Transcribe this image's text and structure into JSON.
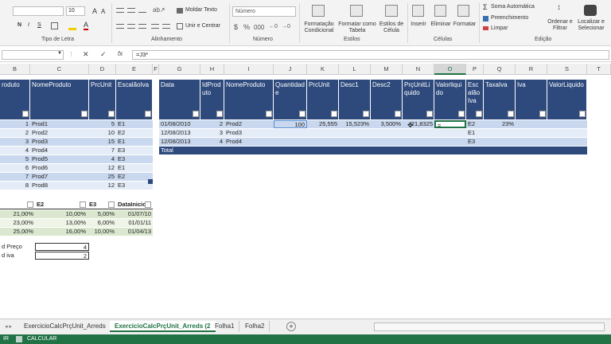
{
  "ribbon": {
    "font_size": "10",
    "groups": {
      "font": "Tipo de Letra",
      "alignment": "Alinhamento",
      "number": "Número",
      "styles": "Estilos",
      "cells": "Células",
      "editing": "Edição"
    },
    "font_style_buttons": {
      "bold": "N",
      "italic": "I",
      "underline": "S"
    },
    "wrap_text": "Moldar Texto",
    "merge_center": "Unir e Centrar",
    "number_format": "Número",
    "cond_format": [
      "Formatação",
      "Condicional"
    ],
    "format_table": [
      "Formatar como",
      "Tabela"
    ],
    "cell_styles": [
      "Estilos de",
      "Célula"
    ],
    "insert": "Inserir",
    "delete": "Eliminar",
    "format": "Formatar",
    "autosum": "Soma Automática",
    "fill": "Preenchimento",
    "clear": "Limpar",
    "sort_filter": [
      "Ordenar e",
      "Filtrar"
    ],
    "find_select": [
      "Localizar e",
      "Selecionar"
    ]
  },
  "formula_bar": {
    "fx": "fx",
    "content": "=J3*"
  },
  "columns": [
    "B",
    "C",
    "D",
    "E",
    "F",
    "G",
    "H",
    "I",
    "J",
    "K",
    "L",
    "M",
    "N",
    "O",
    "P",
    "Q",
    "R",
    "S",
    "T"
  ],
  "table1": {
    "headers": [
      "roduto",
      "NomeProduto",
      "PrcUnit",
      "EscalãoIva"
    ],
    "rows": [
      [
        "1",
        "Prod1",
        "5",
        "E1"
      ],
      [
        "2",
        "Prod2",
        "10",
        "E2"
      ],
      [
        "3",
        "Prod3",
        "15",
        "E1"
      ],
      [
        "4",
        "Prod4",
        "7",
        "E3"
      ],
      [
        "5",
        "Prod5",
        "4",
        "E3"
      ],
      [
        "6",
        "Prod6",
        "12",
        "E1"
      ],
      [
        "7",
        "Prod7",
        "25",
        "E2"
      ],
      [
        "8",
        "Prod8",
        "12",
        "E3"
      ]
    ]
  },
  "table2": {
    "headers": [
      "Data",
      "IdProduto",
      "NomeProduto",
      "Quantidade",
      "PrcUnit",
      "Desc1",
      "Desc2",
      "PrçUnitLiquido",
      "Valorliquido",
      "EscalãoIva",
      "TaxaIva",
      "Iva",
      "ValorLiquido"
    ],
    "rows": [
      [
        "01/08/2010",
        "2",
        "Prod2",
        "100",
        "25,555",
        "15,523%",
        "3,500%",
        "21,8325",
        "=",
        "E2",
        "23%",
        "",
        ""
      ],
      [
        "12/08/2013",
        "3",
        "Prod3",
        "",
        "",
        "",
        "",
        "",
        "",
        "E1",
        "",
        "",
        ""
      ],
      [
        "12/08/2013",
        "4",
        "Prod4",
        "",
        "",
        "",
        "",
        "",
        "",
        "E3",
        "",
        "",
        ""
      ]
    ],
    "total": "Total"
  },
  "table3": {
    "headers": [
      "",
      "E2",
      "E3",
      "DataInicio"
    ],
    "rows": [
      [
        "21,00%",
        "10,00%",
        "5,00%",
        "01/07/10"
      ],
      [
        "23,00%",
        "13,00%",
        "6,00%",
        "01/01/11"
      ],
      [
        "25,00%",
        "16,00%",
        "10,00%",
        "01/04/13"
      ]
    ]
  },
  "lookup": [
    {
      "label": "d Preço",
      "value": "4"
    },
    {
      "label": "d iva",
      "value": "2"
    }
  ],
  "sheets": [
    "ExercicioCalcPrçUnit_Arreds",
    "ExercicioCalcPrçUnit_Arreds (2",
    "Folha1",
    "Folha2"
  ],
  "status": {
    "mode": "IR",
    "calc": "CALCULAR"
  }
}
